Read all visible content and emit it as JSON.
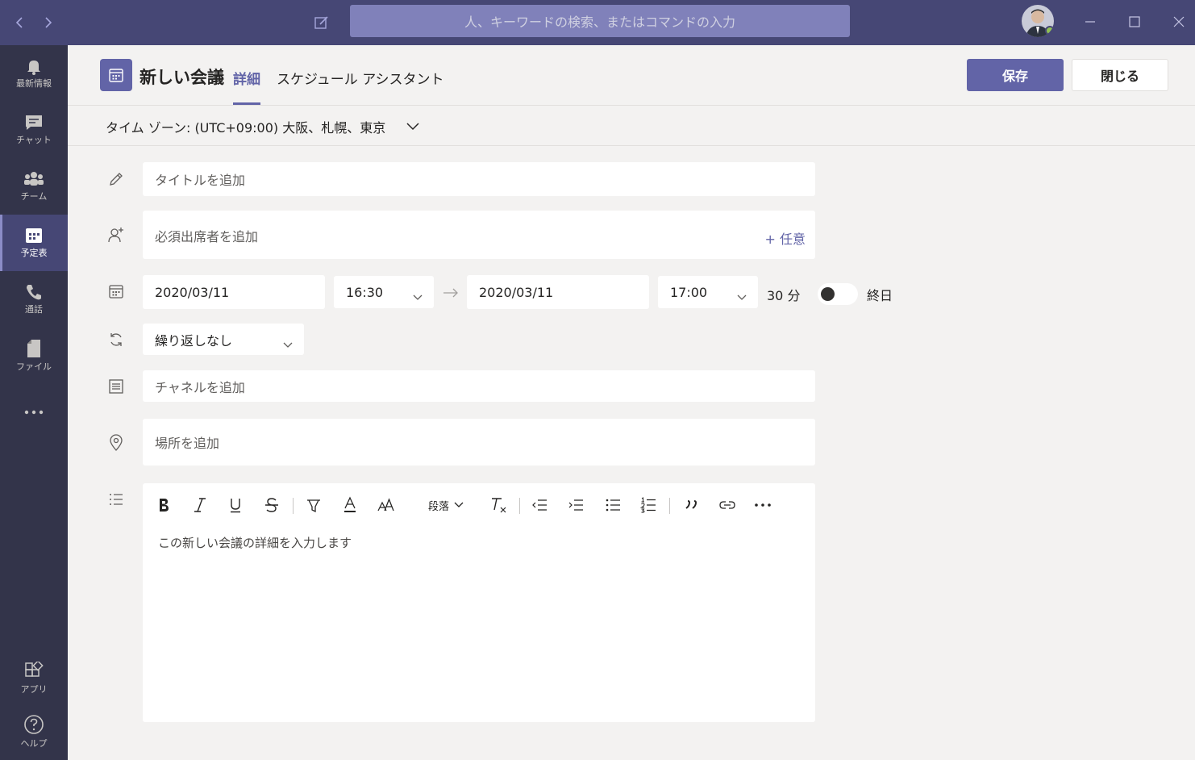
{
  "titlebar": {
    "search_placeholder": "人、キーワードの検索、またはコマンドの入力"
  },
  "rail": {
    "items": [
      {
        "label": "最新情報",
        "icon": "bell-icon"
      },
      {
        "label": "チャット",
        "icon": "chat-icon"
      },
      {
        "label": "チーム",
        "icon": "teams-icon"
      },
      {
        "label": "予定表",
        "icon": "calendar-icon",
        "active": true
      },
      {
        "label": "通話",
        "icon": "phone-icon"
      },
      {
        "label": "ファイル",
        "icon": "file-icon"
      },
      {
        "label": "アプリ",
        "icon": "apps-icon"
      },
      {
        "label": "ヘルプ",
        "icon": "help-icon"
      }
    ]
  },
  "header": {
    "title": "新しい会議",
    "tab_details": "詳細",
    "tab_assistant": "スケジュール アシスタント",
    "save_label": "保存",
    "close_label": "閉じる"
  },
  "timezone": {
    "label": "タイム ゾーン: (UTC+09:00) 大阪、札幌、東京"
  },
  "form": {
    "title_placeholder": "タイトルを追加",
    "attendees_placeholder": "必須出席者を追加",
    "optional_label": "+ 任意",
    "start_date": "2020/03/11",
    "start_time": "16:30",
    "end_date": "2020/03/11",
    "end_time": "17:00",
    "duration": "30 分",
    "all_day_label": "終日",
    "all_day_on": false,
    "repeat": "繰り返しなし",
    "channel_placeholder": "チャネルを追加",
    "location_placeholder": "場所を追加"
  },
  "editor": {
    "paragraph_label": "段落",
    "body_placeholder": "この新しい会議の詳細を入力します"
  },
  "colors": {
    "titlebar": "#464775",
    "rail": "#33344a",
    "accent": "#6264a7",
    "background": "#f3f2f1"
  }
}
